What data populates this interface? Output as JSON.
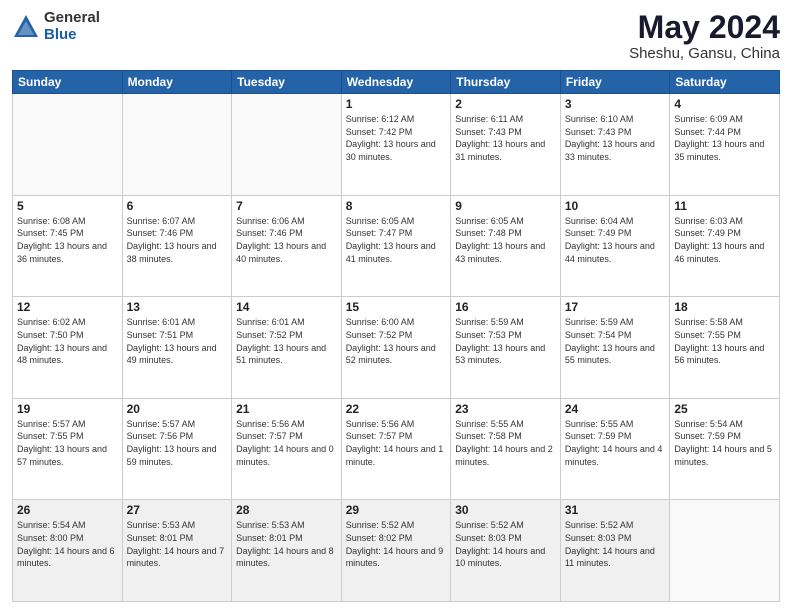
{
  "logo": {
    "general": "General",
    "blue": "Blue"
  },
  "title": "May 2024",
  "location": "Sheshu, Gansu, China",
  "days_of_week": [
    "Sunday",
    "Monday",
    "Tuesday",
    "Wednesday",
    "Thursday",
    "Friday",
    "Saturday"
  ],
  "weeks": [
    [
      {
        "day": "",
        "info": ""
      },
      {
        "day": "",
        "info": ""
      },
      {
        "day": "",
        "info": ""
      },
      {
        "day": "1",
        "info": "Sunrise: 6:12 AM\nSunset: 7:42 PM\nDaylight: 13 hours\nand 30 minutes."
      },
      {
        "day": "2",
        "info": "Sunrise: 6:11 AM\nSunset: 7:43 PM\nDaylight: 13 hours\nand 31 minutes."
      },
      {
        "day": "3",
        "info": "Sunrise: 6:10 AM\nSunset: 7:43 PM\nDaylight: 13 hours\nand 33 minutes."
      },
      {
        "day": "4",
        "info": "Sunrise: 6:09 AM\nSunset: 7:44 PM\nDaylight: 13 hours\nand 35 minutes."
      }
    ],
    [
      {
        "day": "5",
        "info": "Sunrise: 6:08 AM\nSunset: 7:45 PM\nDaylight: 13 hours\nand 36 minutes."
      },
      {
        "day": "6",
        "info": "Sunrise: 6:07 AM\nSunset: 7:46 PM\nDaylight: 13 hours\nand 38 minutes."
      },
      {
        "day": "7",
        "info": "Sunrise: 6:06 AM\nSunset: 7:46 PM\nDaylight: 13 hours\nand 40 minutes."
      },
      {
        "day": "8",
        "info": "Sunrise: 6:05 AM\nSunset: 7:47 PM\nDaylight: 13 hours\nand 41 minutes."
      },
      {
        "day": "9",
        "info": "Sunrise: 6:05 AM\nSunset: 7:48 PM\nDaylight: 13 hours\nand 43 minutes."
      },
      {
        "day": "10",
        "info": "Sunrise: 6:04 AM\nSunset: 7:49 PM\nDaylight: 13 hours\nand 44 minutes."
      },
      {
        "day": "11",
        "info": "Sunrise: 6:03 AM\nSunset: 7:49 PM\nDaylight: 13 hours\nand 46 minutes."
      }
    ],
    [
      {
        "day": "12",
        "info": "Sunrise: 6:02 AM\nSunset: 7:50 PM\nDaylight: 13 hours\nand 48 minutes."
      },
      {
        "day": "13",
        "info": "Sunrise: 6:01 AM\nSunset: 7:51 PM\nDaylight: 13 hours\nand 49 minutes."
      },
      {
        "day": "14",
        "info": "Sunrise: 6:01 AM\nSunset: 7:52 PM\nDaylight: 13 hours\nand 51 minutes."
      },
      {
        "day": "15",
        "info": "Sunrise: 6:00 AM\nSunset: 7:52 PM\nDaylight: 13 hours\nand 52 minutes."
      },
      {
        "day": "16",
        "info": "Sunrise: 5:59 AM\nSunset: 7:53 PM\nDaylight: 13 hours\nand 53 minutes."
      },
      {
        "day": "17",
        "info": "Sunrise: 5:59 AM\nSunset: 7:54 PM\nDaylight: 13 hours\nand 55 minutes."
      },
      {
        "day": "18",
        "info": "Sunrise: 5:58 AM\nSunset: 7:55 PM\nDaylight: 13 hours\nand 56 minutes."
      }
    ],
    [
      {
        "day": "19",
        "info": "Sunrise: 5:57 AM\nSunset: 7:55 PM\nDaylight: 13 hours\nand 57 minutes."
      },
      {
        "day": "20",
        "info": "Sunrise: 5:57 AM\nSunset: 7:56 PM\nDaylight: 13 hours\nand 59 minutes."
      },
      {
        "day": "21",
        "info": "Sunrise: 5:56 AM\nSunset: 7:57 PM\nDaylight: 14 hours\nand 0 minutes."
      },
      {
        "day": "22",
        "info": "Sunrise: 5:56 AM\nSunset: 7:57 PM\nDaylight: 14 hours\nand 1 minute."
      },
      {
        "day": "23",
        "info": "Sunrise: 5:55 AM\nSunset: 7:58 PM\nDaylight: 14 hours\nand 2 minutes."
      },
      {
        "day": "24",
        "info": "Sunrise: 5:55 AM\nSunset: 7:59 PM\nDaylight: 14 hours\nand 4 minutes."
      },
      {
        "day": "25",
        "info": "Sunrise: 5:54 AM\nSunset: 7:59 PM\nDaylight: 14 hours\nand 5 minutes."
      }
    ],
    [
      {
        "day": "26",
        "info": "Sunrise: 5:54 AM\nSunset: 8:00 PM\nDaylight: 14 hours\nand 6 minutes."
      },
      {
        "day": "27",
        "info": "Sunrise: 5:53 AM\nSunset: 8:01 PM\nDaylight: 14 hours\nand 7 minutes."
      },
      {
        "day": "28",
        "info": "Sunrise: 5:53 AM\nSunset: 8:01 PM\nDaylight: 14 hours\nand 8 minutes."
      },
      {
        "day": "29",
        "info": "Sunrise: 5:52 AM\nSunset: 8:02 PM\nDaylight: 14 hours\nand 9 minutes."
      },
      {
        "day": "30",
        "info": "Sunrise: 5:52 AM\nSunset: 8:03 PM\nDaylight: 14 hours\nand 10 minutes."
      },
      {
        "day": "31",
        "info": "Sunrise: 5:52 AM\nSunset: 8:03 PM\nDaylight: 14 hours\nand 11 minutes."
      },
      {
        "day": "",
        "info": ""
      }
    ]
  ]
}
